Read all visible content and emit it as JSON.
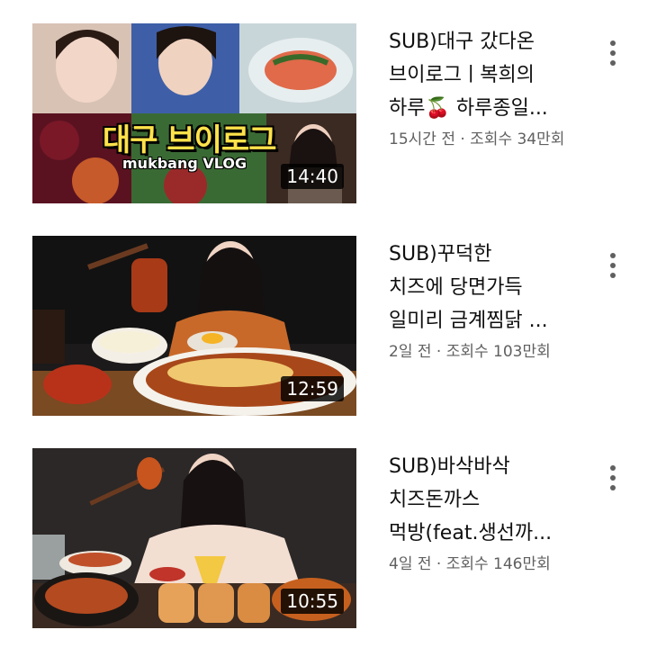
{
  "videos": [
    {
      "title_lines": [
        "SUB)대구 갔다온",
        "브이로그ㅣ복희의",
        "하루🍒 하루종일..."
      ],
      "meta": "15시간 전 · 조회수 34만회",
      "duration": "14:40",
      "thumb_overlay_title": "대구 브이로그",
      "thumb_overlay_sub": "mukbang VLOG",
      "thumb_icon": "vlog-collage-thumbnail"
    },
    {
      "title_lines": [
        "SUB)꾸덕한",
        "치즈에 당면가득",
        "일미리 금계찜닭 ..."
      ],
      "meta": "2일 전 · 조회수 103만회",
      "duration": "12:59",
      "thumb_icon": "cheese-chicken-thumbnail"
    },
    {
      "title_lines": [
        "SUB)바삭바삭",
        "치즈돈까스",
        "먹방(feat.생선까..."
      ],
      "meta": "4일 전 · 조회수 146만회",
      "duration": "10:55",
      "thumb_icon": "cheese-tonkatsu-thumbnail"
    }
  ],
  "colors": {
    "title": "#0f0f0f",
    "meta": "#606060",
    "duration_bg": "#000000"
  },
  "icons": {
    "more": "more-vert-icon"
  }
}
